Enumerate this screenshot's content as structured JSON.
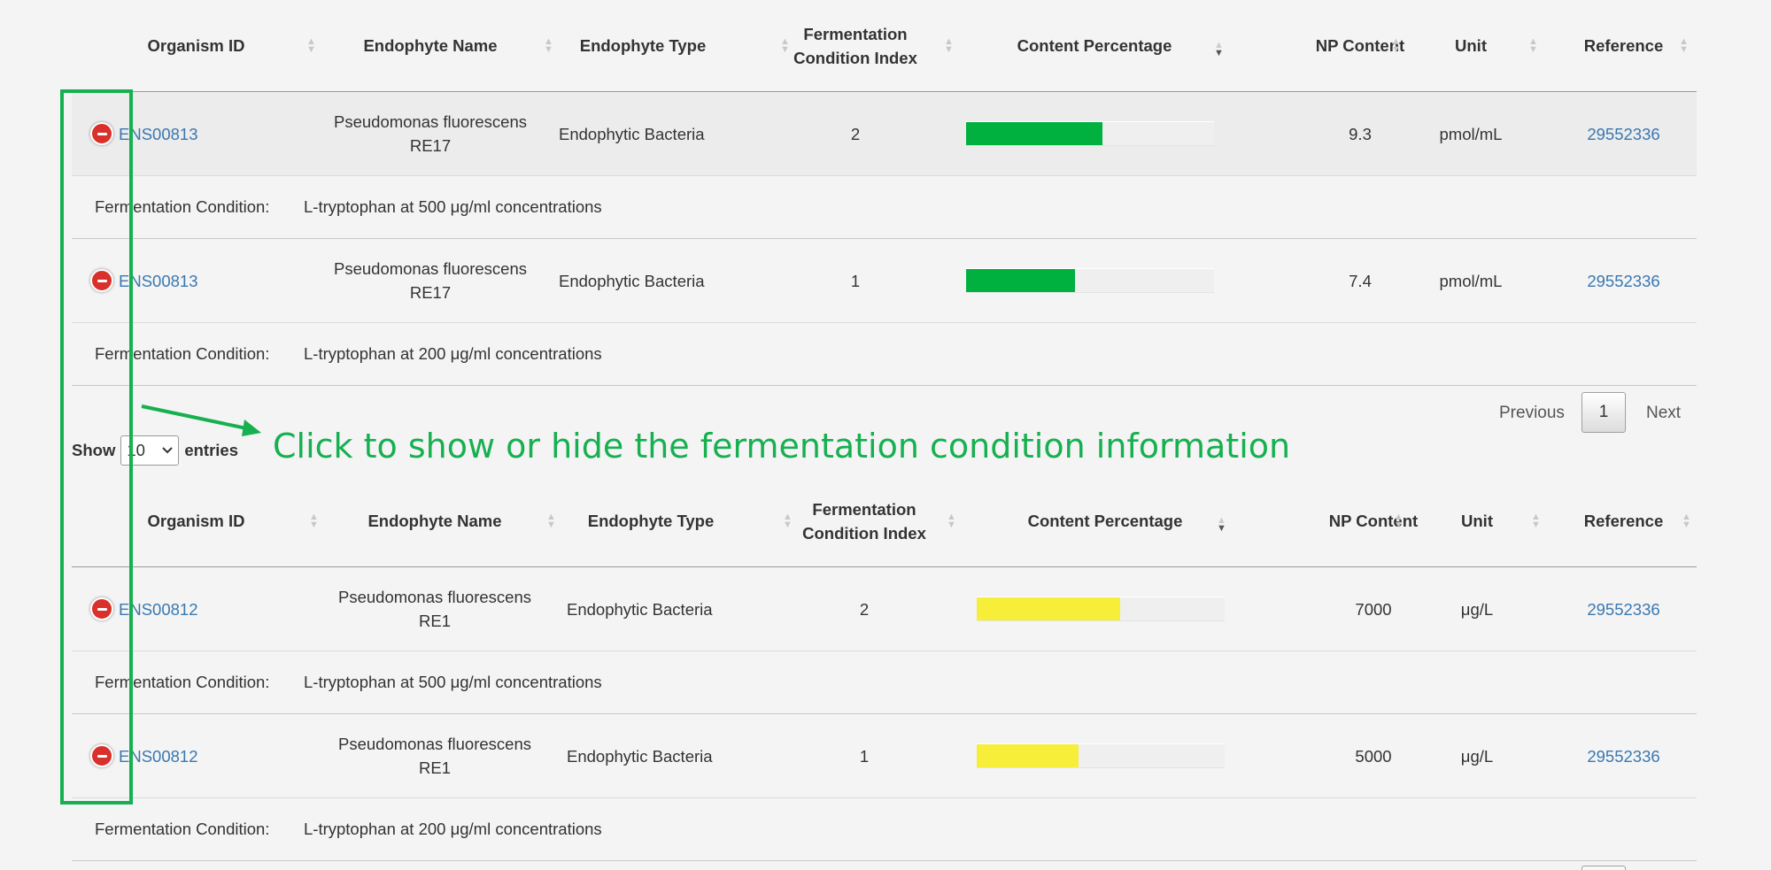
{
  "headers": [
    "Organism ID",
    "Endophyte Name",
    "Endophyte Type",
    "Fermentation Condition Index",
    "Content Percentage",
    "NP Content",
    "Unit",
    "Reference"
  ],
  "table1": {
    "rows": [
      {
        "organism_id": "ENS00813",
        "name_line1": "Pseudomonas fluorescens",
        "name_line2": "RE17",
        "type": "Endophytic Bacteria",
        "index": "2",
        "content_percentage": 0.55,
        "np_content": "9.3",
        "unit": "pmol/mL",
        "reference": "29552336",
        "condition_label": "Fermentation Condition:",
        "condition": "L-tryptophan at 500 μg/ml concentrations"
      },
      {
        "organism_id": "ENS00813",
        "name_line1": "Pseudomonas fluorescens",
        "name_line2": "RE17",
        "type": "Endophytic Bacteria",
        "index": "1",
        "content_percentage": 0.44,
        "np_content": "7.4",
        "unit": "pmol/mL",
        "reference": "29552336",
        "condition_label": "Fermentation Condition:",
        "condition": "L-tryptophan at 200 μg/ml concentrations"
      }
    ],
    "bar_color": "#00b140"
  },
  "pagination": {
    "previous": "Previous",
    "page": "1",
    "next": "Next"
  },
  "length_menu": {
    "show": "Show",
    "value": "10",
    "entries": "entries"
  },
  "annotation": "Click to show or hide the fermentation condition information",
  "annotation_color": "#16b050",
  "table2": {
    "rows": [
      {
        "organism_id": "ENS00812",
        "name_line1": "Pseudomonas fluorescens",
        "name_line2": "RE1",
        "type": "Endophytic Bacteria",
        "index": "2",
        "content_percentage": 0.58,
        "np_content": "7000",
        "unit": "μg/L",
        "reference": "29552336",
        "condition_label": "Fermentation Condition:",
        "condition": "L-tryptophan at 500 μg/ml concentrations"
      },
      {
        "organism_id": "ENS00812",
        "name_line1": "Pseudomonas fluorescens",
        "name_line2": "RE1",
        "type": "Endophytic Bacteria",
        "index": "1",
        "content_percentage": 0.41,
        "np_content": "5000",
        "unit": "μg/L",
        "reference": "29552336",
        "condition_label": "Fermentation Condition:",
        "condition": "L-tryptophan at 200 μg/ml concentrations"
      }
    ],
    "bar_color": "#f7ee3a"
  },
  "icons": {
    "toggle": "minus-circle-icon",
    "sort": "sort-arrows-icon",
    "sort_active": "sort-desc-icon",
    "dropdown": "chevron-down-icon"
  }
}
